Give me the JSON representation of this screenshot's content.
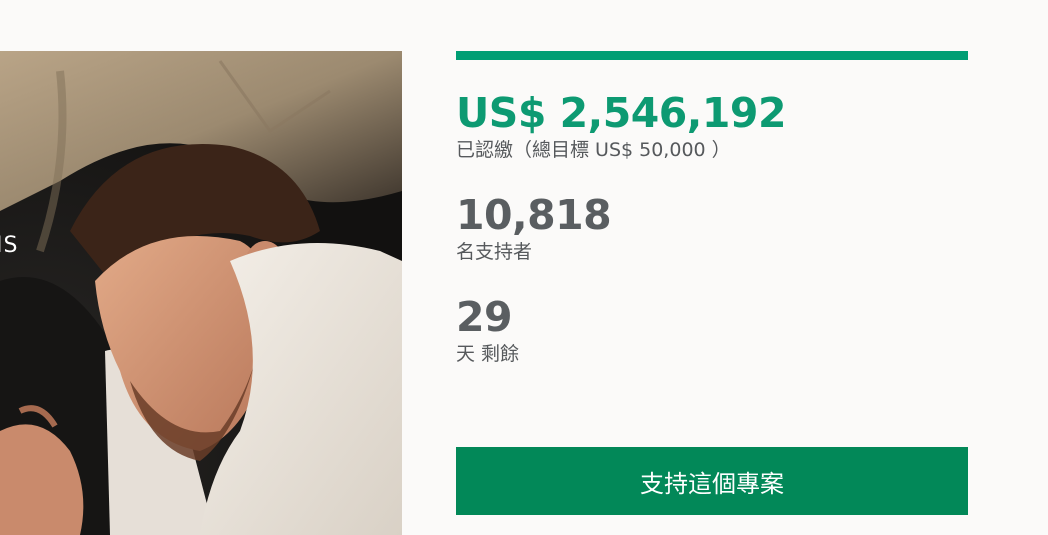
{
  "hero": {
    "caption": "IS",
    "image_icon": "sleeping-man-photo"
  },
  "campaign": {
    "progress_percent": 100,
    "pledged": {
      "amount": "US$ 2,546,192",
      "label": "已認繳（總目標 US$ 50,000 ）"
    },
    "backers": {
      "count": "10,818",
      "label": "名支持者"
    },
    "days": {
      "count": "29",
      "label": "天 剩餘"
    },
    "back_button_label": "支持這個專案"
  },
  "colors": {
    "accent_green": "#0d9a72",
    "button_green": "#028858",
    "progress_fill": "#009e74",
    "stat_gray": "#5a5e61"
  }
}
